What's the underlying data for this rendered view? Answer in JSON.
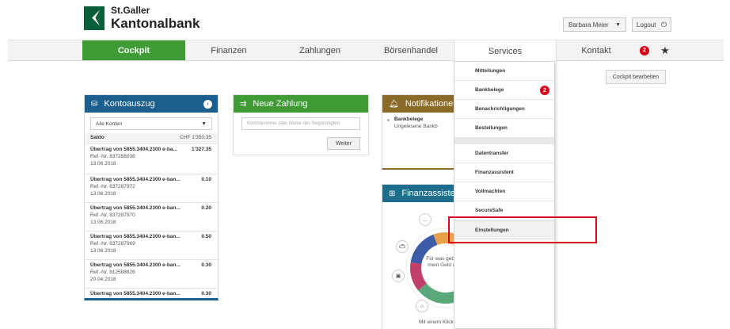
{
  "header": {
    "brand_line1": "St.Galler",
    "brand_line2": "Kantonalbank",
    "user_name": "Barbara Meier",
    "logout_label": "Logout"
  },
  "nav": {
    "items": [
      {
        "label": "Cockpit"
      },
      {
        "label": "Finanzen"
      },
      {
        "label": "Zahlungen"
      },
      {
        "label": "Börsenhandel"
      },
      {
        "label": "Services"
      },
      {
        "label": "Kontakt"
      }
    ],
    "badge_count": "2"
  },
  "cockpit_edit_label": "Cockpit bearbeiten",
  "kontoauszug": {
    "title": "Kontoauszug",
    "select_value": "Alle Konten",
    "saldo_label": "Saldo",
    "saldo_value": "CHF 1'350.35",
    "rows": [
      {
        "title": "Übertrag von 5855.3404.2300 e-ba...",
        "amount": "1'327.35",
        "ref": "Ref.-Nr. 837288036",
        "date": "13.06.2018"
      },
      {
        "title": "Übertrag von 5855.3404.2300 e-ban...",
        "amount": "0.10",
        "ref": "Ref.-Nr. 837287972",
        "date": "13.06.2018"
      },
      {
        "title": "Übertrag von 5855.3404.2300 e-ban...",
        "amount": "0.20",
        "ref": "Ref.-Nr. 837287970",
        "date": "13.06.2018"
      },
      {
        "title": "Übertrag von 5855.3404.2300 e-ban...",
        "amount": "0.50",
        "ref": "Ref.-Nr. 837287969",
        "date": "13.06.2018"
      },
      {
        "title": "Übertrag von 5855.3404.2300 e-ban...",
        "amount": "0.30",
        "ref": "Ref.-Nr. 812588626",
        "date": "20.04.2018"
      },
      {
        "title": "Übertrag von 5855.3404.2300 e-ban...",
        "amount": "0.30",
        "ref": "",
        "date": ""
      }
    ]
  },
  "neue_zahlung": {
    "title": "Neue Zahlung",
    "placeholder": "Kontonummer oder Name des Begünstigten",
    "button": "Weiter"
  },
  "notifikationen": {
    "title": "Notifikatione",
    "item_title": "Bankbelege",
    "item_sub": "Ungelesene Bankb"
  },
  "finanzassistent": {
    "title": "Finanzassiste",
    "center_text": "Für was gebe ich mein Geld aus?",
    "footer": "Mit einem Klick zur Antwort",
    "more": "..."
  },
  "services_menu": {
    "items": [
      {
        "label": "Mitteilungen"
      },
      {
        "label": "Bankbelege",
        "badge": "2"
      },
      {
        "label": "Benachrichtigungen"
      },
      {
        "label": "Bestellungen"
      },
      {
        "label": "Datentransfer"
      },
      {
        "label": "Finanzassistent"
      },
      {
        "label": "Vollmachten"
      },
      {
        "label": "SecureSafe"
      },
      {
        "label": "Einstellungen"
      }
    ]
  },
  "colors": {
    "brand_green": "#3f9c35",
    "brand_blue": "#1a5f8e",
    "alert_red": "#d8001c"
  }
}
